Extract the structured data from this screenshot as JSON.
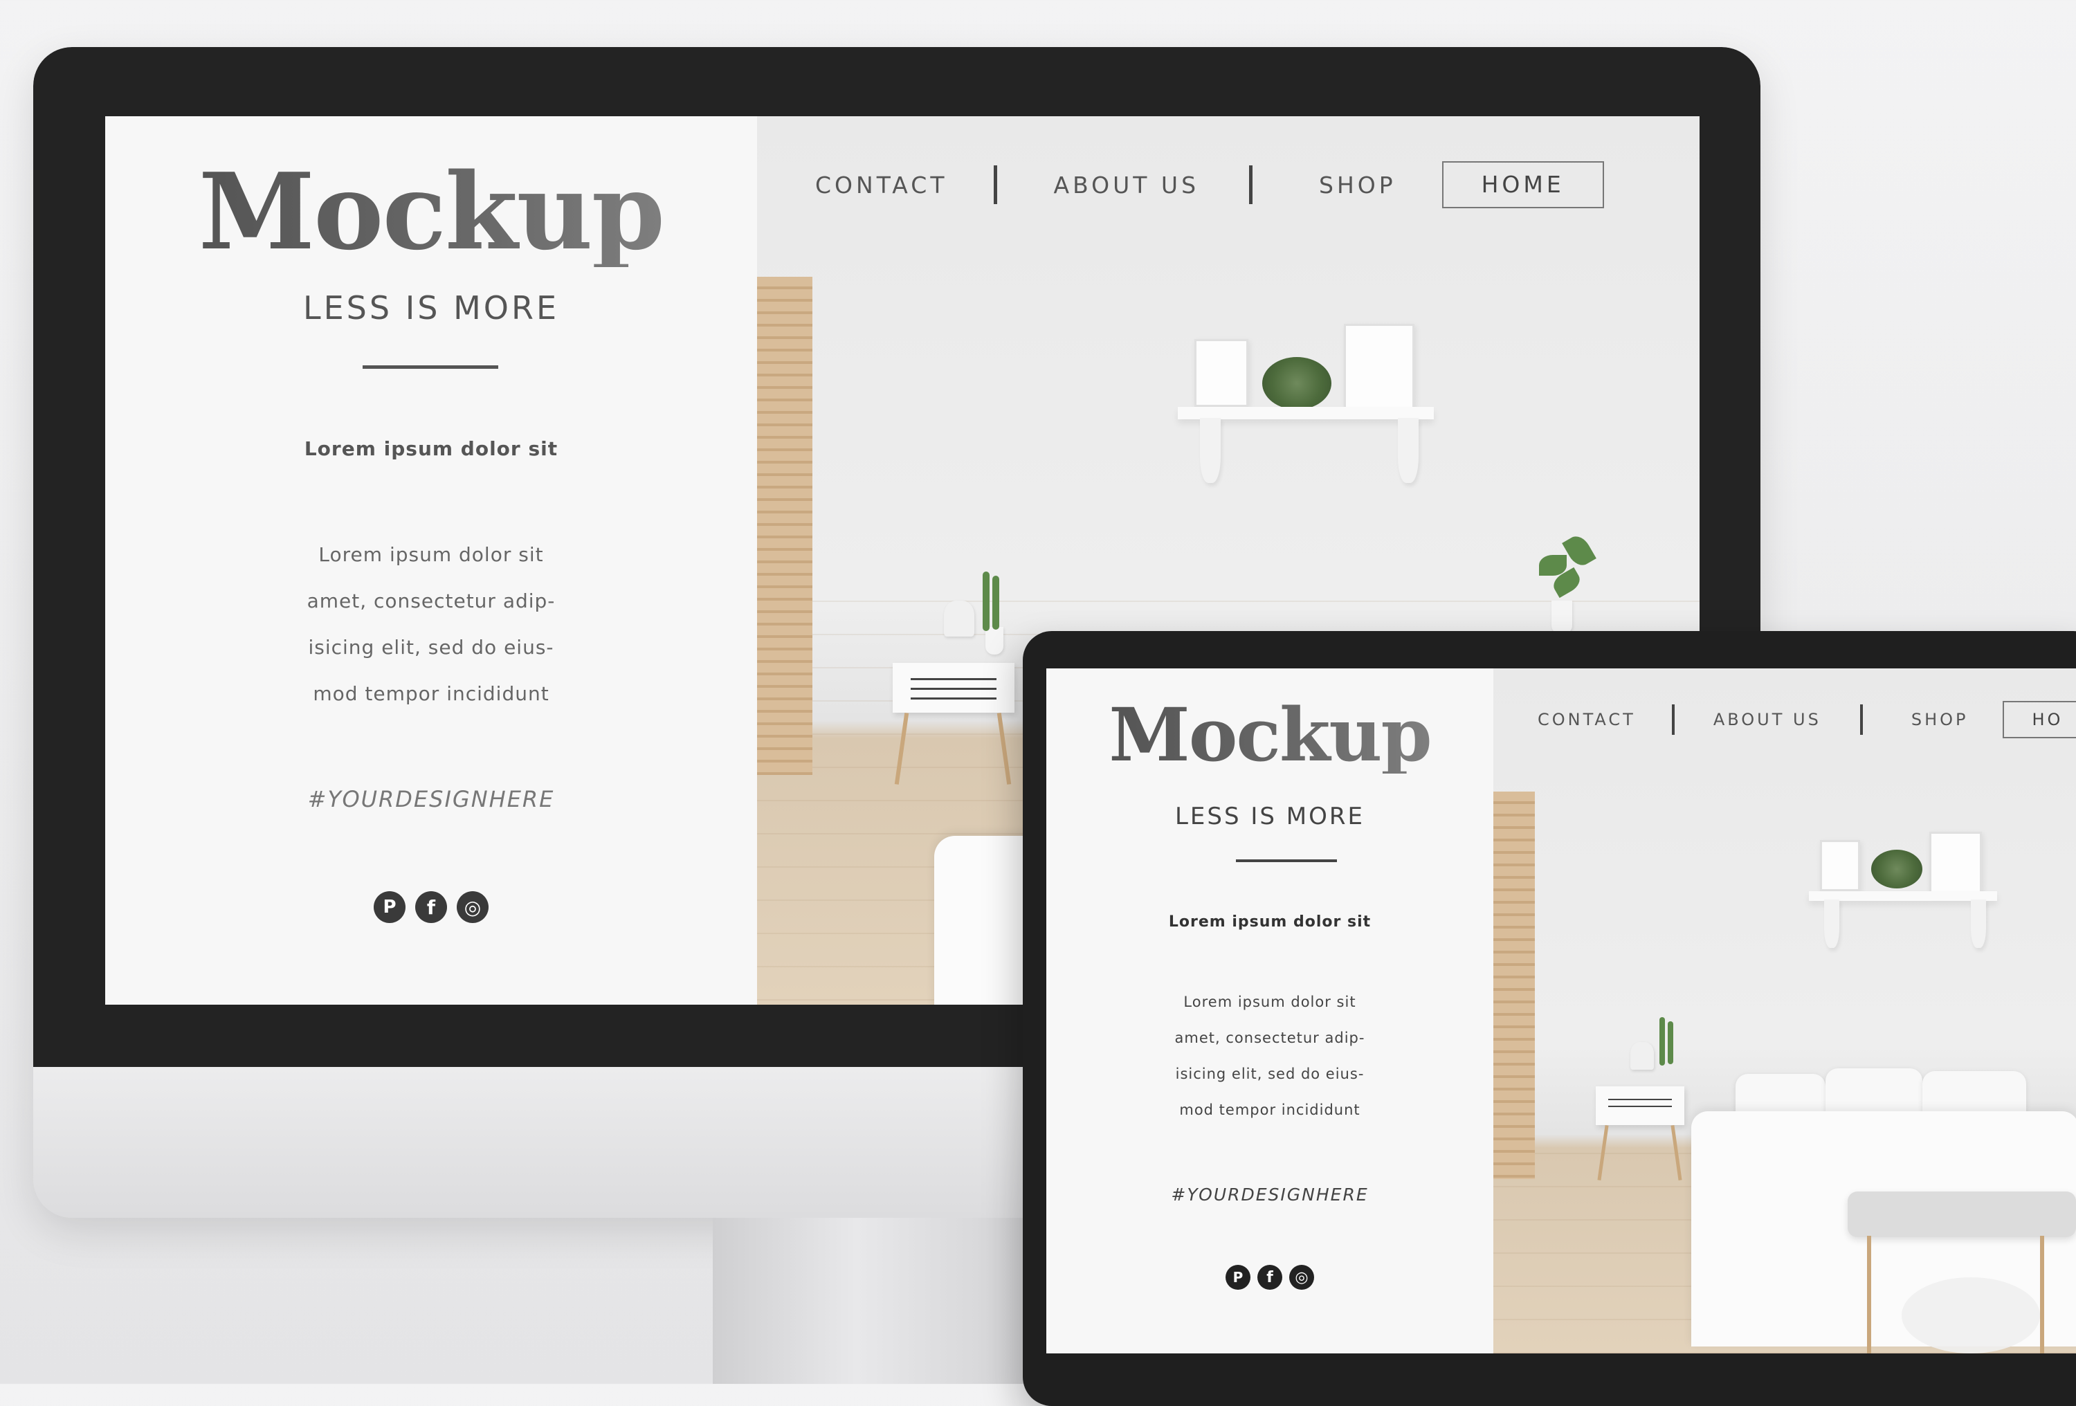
{
  "colors": {
    "bezel": "#232323",
    "panel": "#f7f7f7",
    "text": "#555555",
    "social": "#3a3a3a"
  },
  "monitor": {
    "logo": "Mockup",
    "tagline": "LESS IS MORE",
    "heading": "Lorem ipsum dolor sit",
    "body_lines": [
      "Lorem ipsum dolor sit",
      "amet, consectetur adip-",
      "isicing elit, sed do eius-",
      "mod tempor incididunt"
    ],
    "hashtag": "#YOURDESIGNHERE",
    "nav": {
      "contact": "CONTACT",
      "about": "ABOUT US",
      "shop": "SHOP",
      "home": "HOME"
    },
    "socials": [
      {
        "icon": "pinterest-icon",
        "glyph": "P"
      },
      {
        "icon": "facebook-icon",
        "glyph": "f"
      },
      {
        "icon": "instagram-icon",
        "glyph": "◎"
      }
    ]
  },
  "tablet": {
    "logo": "Mockup",
    "tagline": "LESS IS MORE",
    "heading": "Lorem ipsum dolor sit",
    "body_lines": [
      "Lorem ipsum dolor sit",
      "amet, consectetur adip-",
      "isicing elit, sed do eius-",
      "mod tempor incididunt"
    ],
    "hashtag": "#YOURDESIGNHERE",
    "nav": {
      "contact": "CONTACT",
      "about": "ABOUT US",
      "shop": "SHOP",
      "home": "HO"
    },
    "socials": [
      {
        "icon": "pinterest-icon",
        "glyph": "P"
      },
      {
        "icon": "facebook-icon",
        "glyph": "f"
      },
      {
        "icon": "instagram-icon",
        "glyph": "◎"
      }
    ]
  }
}
